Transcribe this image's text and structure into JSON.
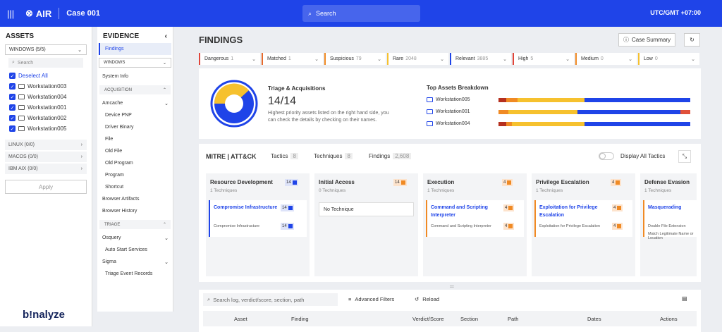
{
  "topbar": {
    "app": "AIR",
    "case": "Case 001",
    "search": "Search",
    "timezone": "UTC/GMT +07:00"
  },
  "assets": {
    "title": "ASSETS",
    "windows": "WINDOWS (5/5)",
    "search_placeholder": "Search",
    "deselect": "Deselect All",
    "items": [
      "Workstation003",
      "Workstation004",
      "Workstation001",
      "Workstation002",
      "Workstation005"
    ],
    "linux": "LINUX (0/0)",
    "macos": "MACOS (0/0)",
    "ibm": "IBM AIX (0/0)",
    "apply": "Apply"
  },
  "brand": "b!nalyze",
  "evidence": {
    "title": "EVIDENCE",
    "findings": "Findings",
    "windows": "WINDOWS",
    "system_info": "System Info",
    "acquisition": "ACQUISITION",
    "amcache": "Amcache",
    "amcache_items": [
      "Device PNP",
      "Driver Binary",
      "File",
      "Old File",
      "Old Program",
      "Program",
      "Shortcut"
    ],
    "browser_artifacts": "Browser Artifacts",
    "browser_history": "Browser History",
    "triage": "TRIAGE",
    "osquery": "Osquery",
    "auto_start": "Auto Start Services",
    "sigma": "Sigma",
    "triage_event": "Triage Event Records"
  },
  "findings": {
    "title": "FINDINGS",
    "case_summary": "Case Summary",
    "filters": [
      {
        "label": "Dangerous",
        "count": "1",
        "color": "#e0453a"
      },
      {
        "label": "Matched",
        "count": "1",
        "color": "#e66a2c"
      },
      {
        "label": "Suspicious",
        "count": "79",
        "color": "#f08a24"
      },
      {
        "label": "Rare",
        "count": "2048",
        "color": "#f6c12e"
      },
      {
        "label": "Relevant",
        "count": "3885",
        "color": "#1f44e8"
      },
      {
        "label": "High",
        "count": "5",
        "color": "#e0453a"
      },
      {
        "label": "Medium",
        "count": "0",
        "color": "#f08a24"
      },
      {
        "label": "Low",
        "count": "0",
        "color": "#f6c12e"
      }
    ]
  },
  "triage": {
    "title": "Triage & Acquisitions",
    "value": "14/14",
    "desc1": "Highest priority assets listed on the right hand side, you",
    "desc2": "can check the details by checking on their names."
  },
  "top_assets": {
    "title": "Top Assets Breakdown",
    "rows": [
      {
        "name": "Workstation005",
        "red": 0.04,
        "orange": 0.06,
        "yellow": 0.35,
        "blue": 0.55
      },
      {
        "name": "Workstation001",
        "red": 0.0,
        "orange": 0.05,
        "yellow": 0.36,
        "blue": 0.54,
        "red2": 0.05
      },
      {
        "name": "Workstation004",
        "red": 0.04,
        "orange": 0.03,
        "yellow": 0.38,
        "blue": 0.55
      }
    ]
  },
  "mitre": {
    "logo": "MITRE | ATT&CK",
    "tactics": "Tactics",
    "tactics_count": "8",
    "techniques": "Techniques",
    "techniques_count": "8",
    "findings": "Findings",
    "findings_count": "2,608",
    "display_all": "Display All Tactics",
    "columns": [
      {
        "title": "Resource Development",
        "sub": "1 Techniques",
        "badge": "14",
        "techs": [
          {
            "name": "Compromise Infrastructure",
            "sub": "Compromise Infrastructure",
            "badge": "14"
          }
        ]
      },
      {
        "title": "Initial Access",
        "sub": "0 Techniques",
        "badge": "14",
        "none": "No Technique"
      },
      {
        "title": "Execution",
        "sub": "1 Techniques",
        "badge": "4",
        "techs": [
          {
            "name": "Command and Scripting Interpreter",
            "sub": "Command and Scripting Interpreter",
            "badge": "4"
          }
        ]
      },
      {
        "title": "Privilege Escalation",
        "sub": "1 Techniques",
        "badge": "4",
        "techs": [
          {
            "name": "Exploitation for Privilege Escalation",
            "sub": "Exploitation for Privilege Escalation",
            "badge": "4"
          }
        ]
      },
      {
        "title": "Defense Evasion",
        "sub": "1 Techniques",
        "techs": [
          {
            "name": "Masquerading",
            "sub": "Double File Extension",
            "sub2": "Match Legitimate Name or Location"
          }
        ]
      }
    ]
  },
  "table": {
    "search_placeholder": "Search log, verdict/score, section, path",
    "advanced": "Advanced Filters",
    "reload": "Reload",
    "headers": [
      "Asset",
      "Finding",
      "Verdict/Score",
      "Section",
      "Path",
      "Dates",
      "Actions"
    ]
  }
}
